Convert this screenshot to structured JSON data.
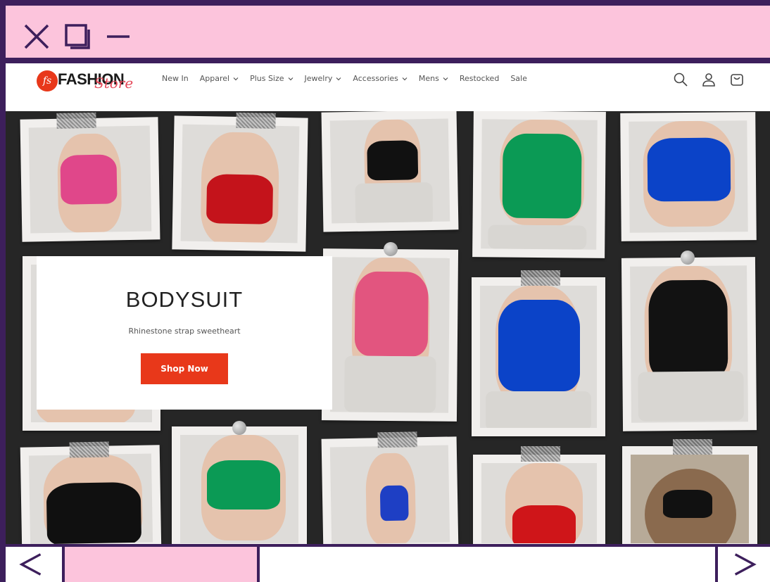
{
  "window": {
    "controls": [
      "close-icon",
      "restore-icon",
      "minimize-icon"
    ],
    "accent_color": "#fcc4dc",
    "border_color": "#3d1f5c"
  },
  "store": {
    "logo_badge": "fs",
    "logo_word": "FASHION",
    "logo_script": "Store",
    "nav": [
      {
        "label": "New In",
        "dropdown": false
      },
      {
        "label": "Apparel",
        "dropdown": true
      },
      {
        "label": "Plus Size",
        "dropdown": true
      },
      {
        "label": "Jewelry",
        "dropdown": true
      },
      {
        "label": "Accessories",
        "dropdown": true
      },
      {
        "label": "Mens",
        "dropdown": true
      },
      {
        "label": "Restocked",
        "dropdown": false
      },
      {
        "label": "Sale",
        "dropdown": false
      }
    ],
    "icons": [
      "search-icon",
      "account-icon",
      "cart-icon"
    ],
    "brand_color": "#e8381a"
  },
  "hero": {
    "title": "BODYSUIT",
    "subtitle": "Rhinestone strap sweetheart",
    "cta_label": "Shop Now"
  },
  "bottom_nav": {
    "prev_label": "<",
    "next_label": ">",
    "progress": 0.3
  }
}
